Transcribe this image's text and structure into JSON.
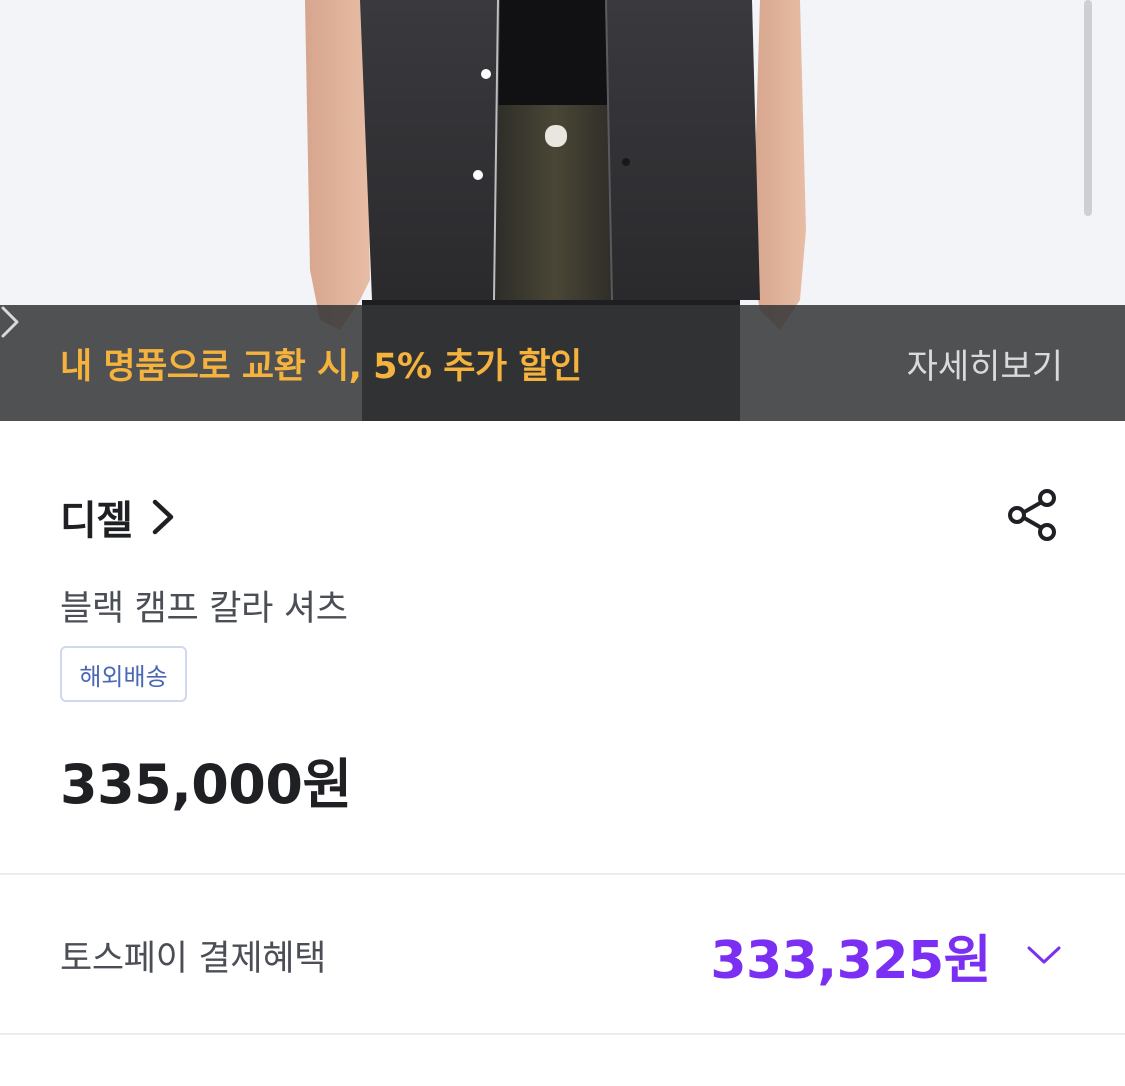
{
  "promo": {
    "text": "내 명품으로 교환 시, 5% 추가 할인",
    "more_label": "자세히보기"
  },
  "product": {
    "brand": "디젤",
    "name": "블랙 캠프 칼라 셔츠",
    "badge": "해외배송",
    "price": "335,000원"
  },
  "payment": {
    "label": "토스페이 결제혜택",
    "price": "333,325원"
  },
  "icons": {
    "brand_link": "chevron-right-icon",
    "share": "share-icon",
    "promo_more": "chevron-right-icon",
    "expand": "chevron-down-icon"
  },
  "colors": {
    "promo_text": "#f5b23c",
    "accent_purple": "#7b2ff2",
    "badge_text": "#4a67b5"
  }
}
